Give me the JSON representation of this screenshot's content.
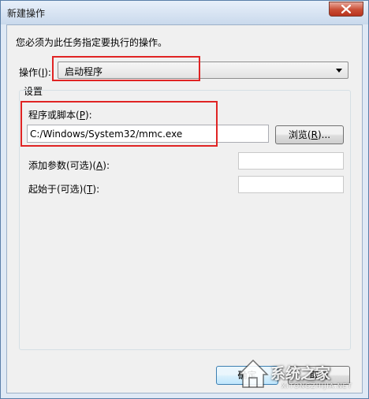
{
  "window": {
    "title": "新建操作"
  },
  "dialog": {
    "instruction": "您必须为此任务指定要执行的操作。",
    "action_label_prefix": "操作(",
    "action_label_key": "I",
    "action_label_suffix": "):",
    "action_value": "启动程序",
    "settings_label": "设置",
    "program_label_prefix": "程序或脚本(",
    "program_label_key": "P",
    "program_label_suffix": "):",
    "program_value": "C:/Windows/System32/mmc.exe",
    "browse_prefix": "浏览(",
    "browse_key": "R",
    "browse_suffix": ")...",
    "args_label_prefix": "添加参数(可选)(",
    "args_label_key": "A",
    "args_label_suffix": "):",
    "args_value": "",
    "start_label_prefix": "起始于(可选)(",
    "start_label_key": "T",
    "start_label_suffix": "):",
    "start_value": "",
    "ok_label": "确定",
    "cancel_label": "取消"
  },
  "watermark": {
    "text": "系统之家",
    "sub": "XITONGZHIJIA.NET"
  },
  "colors": {
    "highlight": "#e02424",
    "window_frame": "#5a7fa8"
  }
}
